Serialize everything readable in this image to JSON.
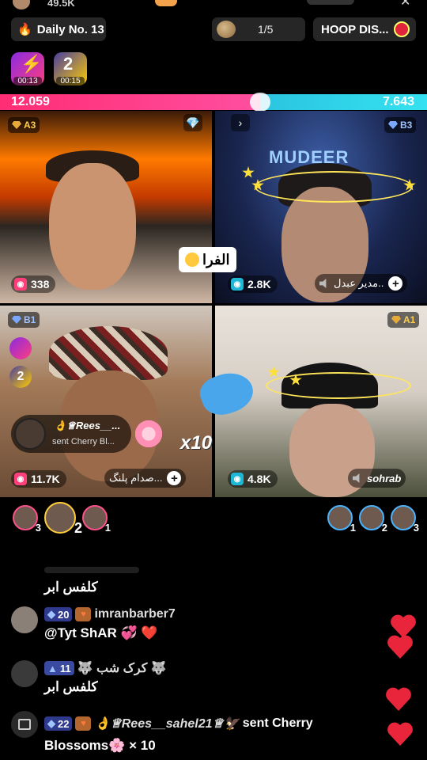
{
  "header": {
    "likes": "49.5K",
    "daily_label": "Daily No. 13",
    "rank_progress": "1/5",
    "hoop_label": "HOOP DIS...",
    "badge1_timer": "00:13",
    "badge2_timer": "00:15",
    "badge2_number": "2"
  },
  "battle": {
    "left_score": "12.059",
    "right_score": "7.643",
    "left_fraction": 0.61
  },
  "tiles": [
    {
      "rank": "A3",
      "viewers": "338"
    },
    {
      "rank": "B3",
      "viewers": "2.8K",
      "name": "مدير عبدل..",
      "overlay_text": "MUDEER"
    },
    {
      "rank": "B1",
      "viewers": "11.7K",
      "name": "صدام پلنگ..."
    },
    {
      "rank": "A1",
      "viewers": "4.8K",
      "name": "sohrab"
    }
  ],
  "caption": "الفرا",
  "gift_toast": {
    "user": "👌♕Rees__...",
    "desc": "sent Cherry Bl...",
    "multiplier": "x10"
  },
  "side_badge_number": "2",
  "supporters_left": [
    "3",
    "2",
    "1"
  ],
  "supporters_right": [
    "1",
    "2",
    "3"
  ],
  "chat": [
    {
      "message": "كلفس ابر"
    },
    {
      "level": "20",
      "user": "imranbarber7",
      "message": "@Tyt ShAR 💞 ❤️"
    },
    {
      "level": "11",
      "user": "🐺 كرک شب 🐺",
      "message": "كلفس ابر"
    },
    {
      "level": "22",
      "user": "👌♕Rees__sahel21♕🦅",
      "action": "sent Cherry",
      "message": "Blossoms🌸 × 10"
    }
  ],
  "colors": {
    "left_team": "#ff2d74",
    "right_team": "#2bc4e0",
    "heart": "#e8253a"
  }
}
